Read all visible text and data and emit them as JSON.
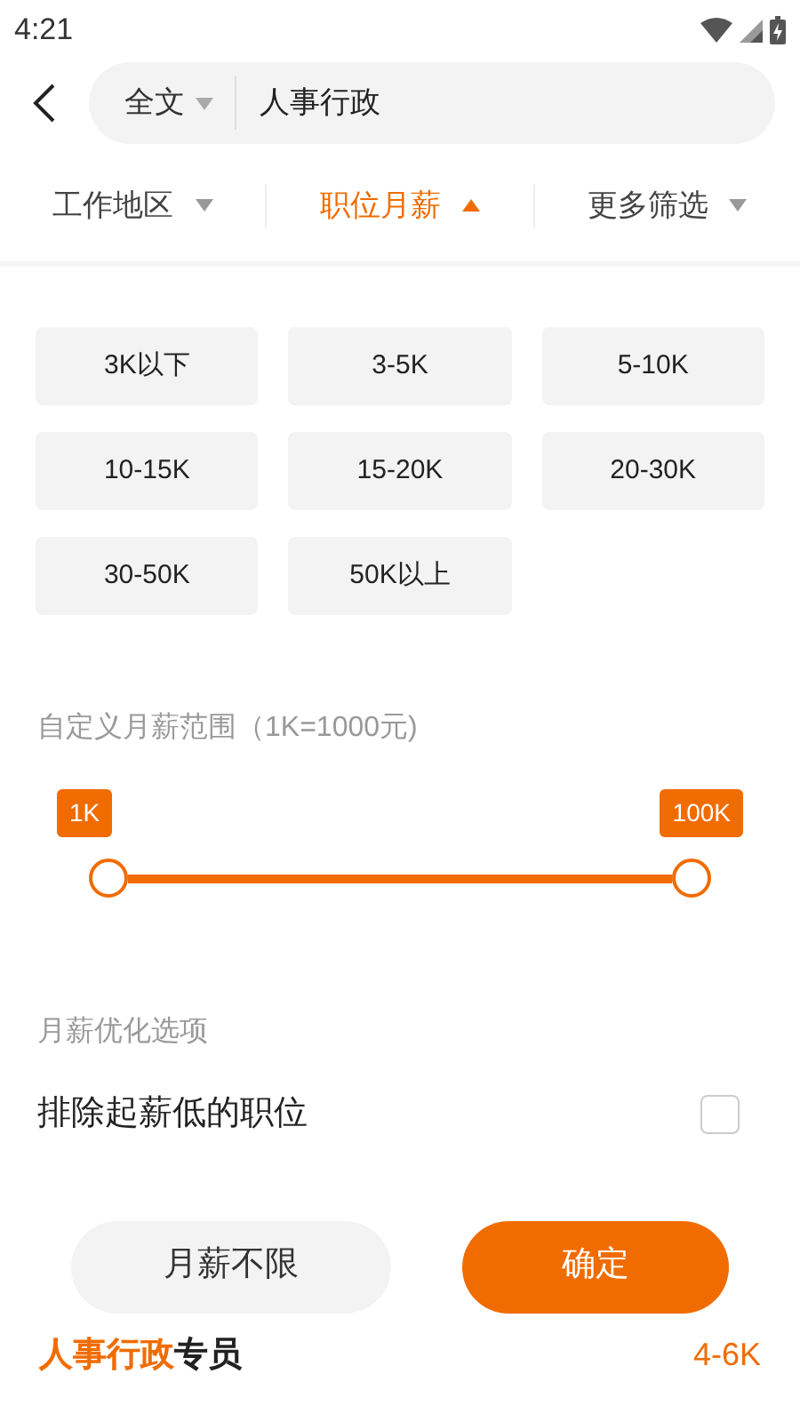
{
  "status_bar": {
    "time": "4:21"
  },
  "search": {
    "scope": "全文",
    "query": "人事行政"
  },
  "filters": [
    {
      "label": "工作地区",
      "selected": false
    },
    {
      "label": "职位月薪",
      "selected": true
    },
    {
      "label": "更多筛选",
      "selected": false
    }
  ],
  "salary_options": [
    {
      "label": "3K以下",
      "selected": false
    },
    {
      "label": "3-5K",
      "selected": false
    },
    {
      "label": "5-10K",
      "selected": false
    },
    {
      "label": "10-15K",
      "selected": false
    },
    {
      "label": "15-20K",
      "selected": false
    },
    {
      "label": "20-30K",
      "selected": false
    },
    {
      "label": "30-50K",
      "selected": false
    },
    {
      "label": "50K以上",
      "selected": false
    }
  ],
  "custom_range": {
    "title": "自定义月薪范围（1K=1000元)",
    "low": {
      "label": "1K"
    },
    "high": {
      "label": "100K"
    }
  },
  "optimization": {
    "title": "月薪优化选项",
    "option": {
      "label": "排除起薪低的职位",
      "checked": false
    }
  },
  "buttons": {
    "reset": "月薪不限",
    "confirm": "确定"
  },
  "result_preview": {
    "title_highlight": "人事行政",
    "title_rest": "专员",
    "salary": "4-6K"
  }
}
